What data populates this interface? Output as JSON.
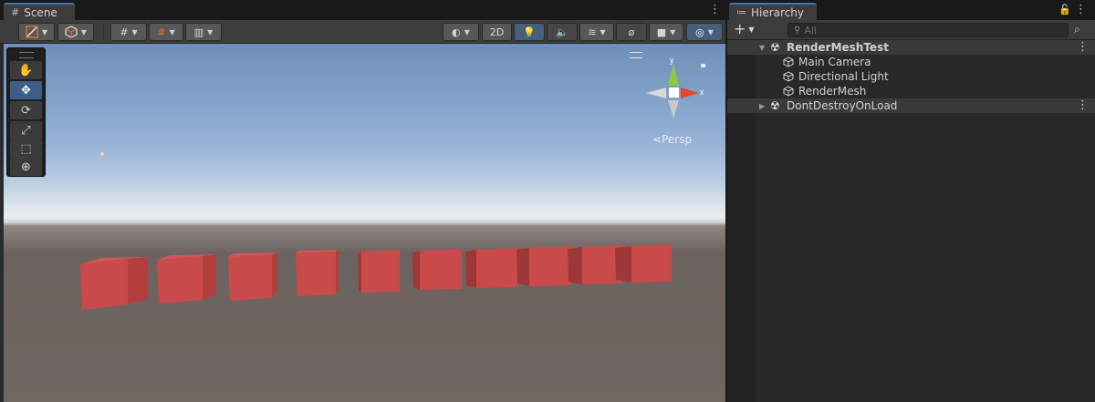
{
  "scene": {
    "tab_title": "Scene",
    "tab_icon": "grid-icon",
    "toolbar": {
      "mode_2d_label": "2D"
    },
    "tools": [
      "hand-tool",
      "move-tool",
      "rotate-tool",
      "scale-tool",
      "rect-tool",
      "transform-tool"
    ],
    "active_tool": "move-tool",
    "gizmo": {
      "projection_label": "Persp",
      "axis_y_label": "y",
      "axis_x_label": "x",
      "colors": {
        "y": "#8ccc3c",
        "x": "#e8452c",
        "neutral": "#d8d8d8"
      }
    },
    "cube_color": "#c94a4a",
    "cube_count": 10
  },
  "hierarchy": {
    "tab_title": "Hierarchy",
    "search_placeholder": "All",
    "add_label": "+",
    "items": [
      {
        "label": "RenderMeshTest",
        "type": "scene",
        "expanded": true
      },
      {
        "label": "Main Camera",
        "type": "gameobject"
      },
      {
        "label": "Directional Light",
        "type": "gameobject"
      },
      {
        "label": "RenderMesh",
        "type": "gameobject"
      },
      {
        "label": "DontDestroyOnLoad",
        "type": "scene",
        "expanded": false
      }
    ]
  },
  "colors": {
    "accent": "#3a79bb",
    "panel": "#282828",
    "toolbar": "#3c3c3c"
  }
}
